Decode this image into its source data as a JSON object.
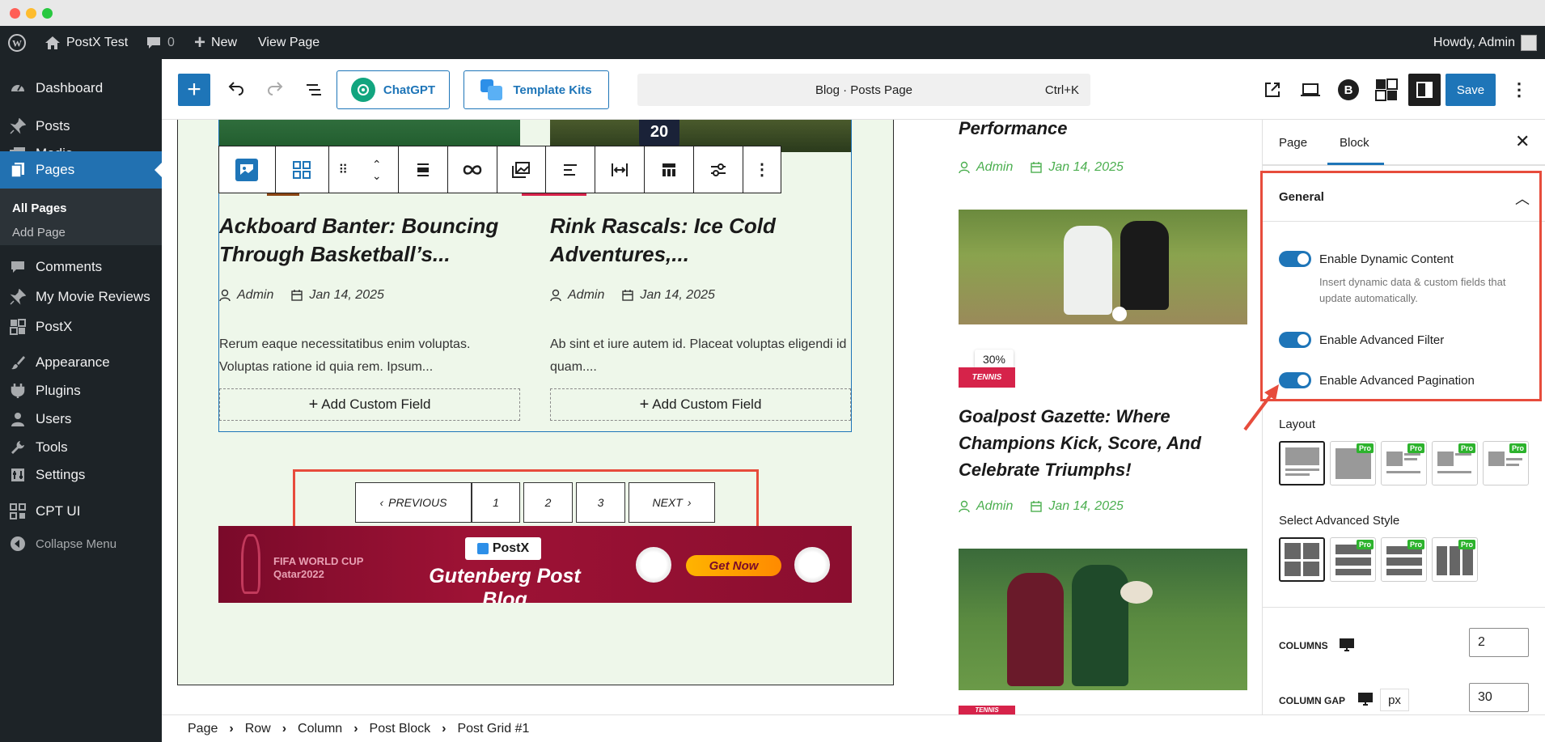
{
  "adminbar": {
    "site_name": "PostX Test",
    "comments_count": "0",
    "new_label": "New",
    "view_page_label": "View Page",
    "howdy": "Howdy, Admin"
  },
  "sidebar": {
    "items": [
      {
        "label": "Dashboard",
        "icon": "dashboard-icon"
      },
      {
        "label": "Posts",
        "icon": "pin-icon"
      },
      {
        "label": "Media",
        "icon": "media-icon"
      },
      {
        "label": "Pages",
        "icon": "pages-icon"
      },
      {
        "label": "Comments",
        "icon": "comment-icon"
      },
      {
        "label": "My Movie Reviews",
        "icon": "pin-icon"
      },
      {
        "label": "PostX",
        "icon": "postx-icon"
      },
      {
        "label": "Appearance",
        "icon": "brush-icon"
      },
      {
        "label": "Plugins",
        "icon": "plugin-icon"
      },
      {
        "label": "Users",
        "icon": "user-icon"
      },
      {
        "label": "Tools",
        "icon": "wrench-icon"
      },
      {
        "label": "Settings",
        "icon": "settings-icon"
      },
      {
        "label": "CPT UI",
        "icon": "cpt-icon"
      },
      {
        "label": "Collapse Menu",
        "icon": "collapse-icon"
      }
    ],
    "subitems": [
      "All Pages",
      "Add Page"
    ]
  },
  "toolbar": {
    "chatgpt_label": "ChatGPT",
    "template_kits_label": "Template Kits",
    "doc_title": "Blog · Posts Page",
    "shortcut": "Ctrl+K",
    "save_label": "Save"
  },
  "posts": [
    {
      "title": "Ackboard Banter: Bouncing Through Basketball’s...",
      "author": "Admin",
      "date": "Jan 14, 2025",
      "excerpt": "Rerum eaque necessitatibus enim voluptas. Voluptas ratione id quia rem. Ipsum...",
      "add_field": "Add Custom Field"
    },
    {
      "title": "Rink Rascals: Ice Cold Adventures,...",
      "author": "Admin",
      "date": "Jan 14, 2025",
      "excerpt": "Ab sint et iure autem id. Placeat voluptas eligendi id quam....",
      "add_field": "Add Custom Field"
    }
  ],
  "pagination": {
    "previous": "PREVIOUS",
    "pages": [
      "1",
      "2",
      "3"
    ],
    "next": "NEXT"
  },
  "banner": {
    "brand": "PostX",
    "title": "Gutenberg Post Blog",
    "cta": "Get Now",
    "event": "FIFA WORLD CUP Qatar2022"
  },
  "right_posts": [
    {
      "title_tail": "Performance",
      "author": "Admin",
      "date": "Jan 14, 2025"
    },
    {
      "tag": "TENNIS",
      "title": "Goalpost Gazette: Where Champions Kick, Score, And Celebrate Triumphs!",
      "author": "Admin",
      "date": "Jan 14, 2025"
    },
    {
      "tag": "TENNIS"
    }
  ],
  "zoom_badge": "30%",
  "panel": {
    "tabs": [
      "Page",
      "Block"
    ],
    "section": "General",
    "toggles": [
      {
        "label": "Enable Dynamic Content",
        "help": "Insert dynamic data & custom fields that update automatically.",
        "on": true
      },
      {
        "label": "Enable Advanced Filter",
        "on": true
      },
      {
        "label": "Enable Advanced Pagination",
        "on": true
      }
    ],
    "layout_label": "Layout",
    "style_label": "Select Advanced Style",
    "pro": "Pro",
    "columns_label": "COLUMNS",
    "columns_value": "2",
    "gap_label": "COLUMN GAP",
    "gap_unit": "px",
    "gap_value": "30"
  },
  "breadcrumb": [
    "Page",
    "Row",
    "Column",
    "Post Block",
    "Post Grid #1"
  ],
  "colors": {
    "accent": "#1e75b8",
    "admin_bg": "#1d2327",
    "highlight": "#e74c3c",
    "meta_green": "#4caf50",
    "tag_red": "#d6234a"
  }
}
